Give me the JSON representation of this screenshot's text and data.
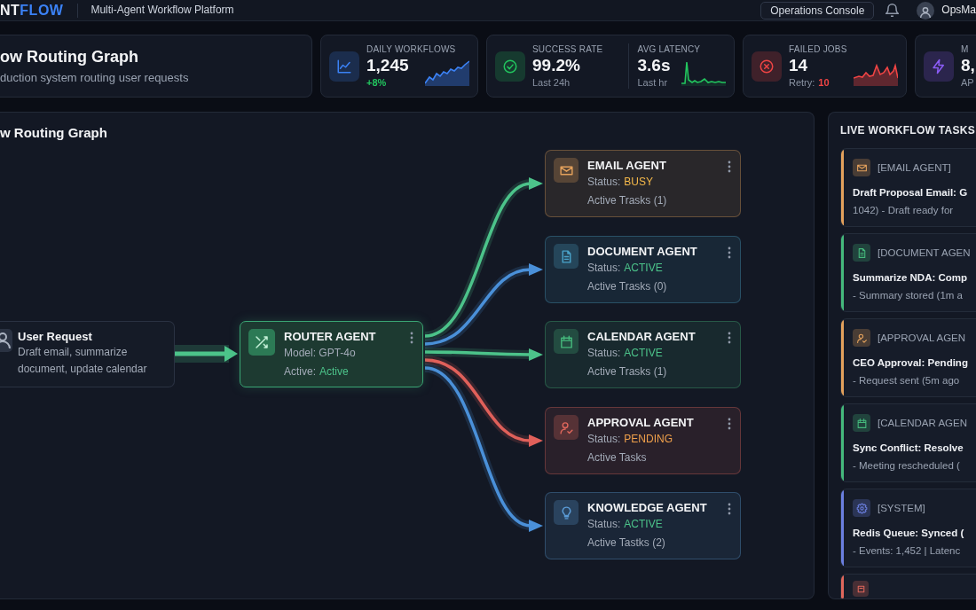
{
  "header": {
    "logo": {
      "lead": "NT",
      "accent": "FLOW"
    },
    "subtitle": "Multi-Agent Workflow Platform",
    "console_button": "Operations Console",
    "user_name": "OpsMa"
  },
  "overview": {
    "title": "ow Routing Graph",
    "subtitle": "duction system routing user requests"
  },
  "stats": [
    {
      "color": "#3b82f6",
      "metrics": [
        {
          "label": "DAILY WORKFLOWS",
          "value": "1,245",
          "accent": {
            "text": "+8%",
            "color": "#22c55e"
          },
          "kind": "rising"
        }
      ]
    },
    {
      "color": "#22c55e",
      "metrics": [
        {
          "label": "SUCCESS RATE",
          "value": "99.2%",
          "note": "Last 24h",
          "kind": "plain"
        },
        {
          "label": "AVG LATENCY",
          "value": "3.6s",
          "note": "Last hr",
          "kind": "spike"
        }
      ]
    },
    {
      "color": "#ef4444",
      "metrics": [
        {
          "label": "FAILED JOBS",
          "value": "14",
          "note": "Retry:",
          "accent": {
            "text": "10",
            "color": "#ef4444"
          },
          "kind": "waves"
        }
      ]
    },
    {
      "color": "#8b5cf6",
      "metrics": [
        {
          "label": "M",
          "value": "8,",
          "note": "AP",
          "kind": "plain"
        }
      ]
    }
  ],
  "graph": {
    "title": "w Routing Graph",
    "source": {
      "title": "User Request",
      "description": "Draft email, summarize document, update calendar"
    },
    "router": {
      "title": "ROUTER AGENT",
      "model": "Model: GPT-4o",
      "status_label": "Active:",
      "status": "Active"
    },
    "agents": [
      {
        "name": "EMAIL AGENT",
        "status_label": "Status:",
        "status": {
          "text": "BUSY",
          "color": "#f5b94a"
        },
        "tasks": "Active Trasks (1)",
        "color": "#e3a15c",
        "edge": {
          "color": "#4cc38a"
        }
      },
      {
        "name": "DOCUMENT AGENT",
        "status_label": "Status:",
        "status": {
          "text": "ACTIVE",
          "color": "#4cc38a"
        },
        "tasks": "Active Trasks (0)",
        "color": "#4aa3c9",
        "edge": {
          "color": "#4a90d9"
        }
      },
      {
        "name": "CALENDAR AGENT",
        "status_label": "Status:",
        "status": {
          "text": "ACTIVE",
          "color": "#4cc38a"
        },
        "tasks": "Active Trasks (1)",
        "color": "#45b97c",
        "edge": {
          "color": "#4cc38a"
        }
      },
      {
        "name": "APPROVAL AGENT",
        "status_label": "Status:",
        "status": {
          "text": "PENDING",
          "color": "#f0a04b"
        },
        "tasks": "Active Tasks",
        "color": "#e0675c",
        "edge": {
          "color": "#e0605a"
        }
      },
      {
        "name": "KNOWLEDGE AGENT",
        "status_label": "Status:",
        "status": {
          "text": "ACTIVE",
          "color": "#4cc38a"
        },
        "tasks": "Active Tastks (2)",
        "color": "#5b9bd5",
        "edge": {
          "color": "#4a90d9"
        }
      }
    ]
  },
  "tasks": {
    "title": "LIVE WORKFLOW TASKS",
    "items": [
      {
        "color": "#e3a15c",
        "source": "[EMAIL AGENT]",
        "heading": "Draft Proposal Email: G",
        "detail": "1042) - Draft ready for"
      },
      {
        "color": "#45b97c",
        "source": "[DOCUMENT AGEN",
        "heading": "Summarize NDA: Comp",
        "detail": "- Summary stored (1m a"
      },
      {
        "color": "#e3a15c",
        "source": "[APPROVAL AGEN",
        "heading": "CEO Approval: Pending",
        "detail": "- Request sent (5m ago"
      },
      {
        "color": "#45b97c",
        "source": "[CALENDAR AGEN",
        "heading": "Sync Conflict: Resolve",
        "detail": "- Meeting rescheduled ("
      },
      {
        "color": "#6b7fe0",
        "source": "[SYSTEM]",
        "heading": "Redis Queue: Synced (",
        "detail": "- Events: 1,452 | Latenc"
      },
      {
        "color": "#e0675c"
      }
    ]
  }
}
